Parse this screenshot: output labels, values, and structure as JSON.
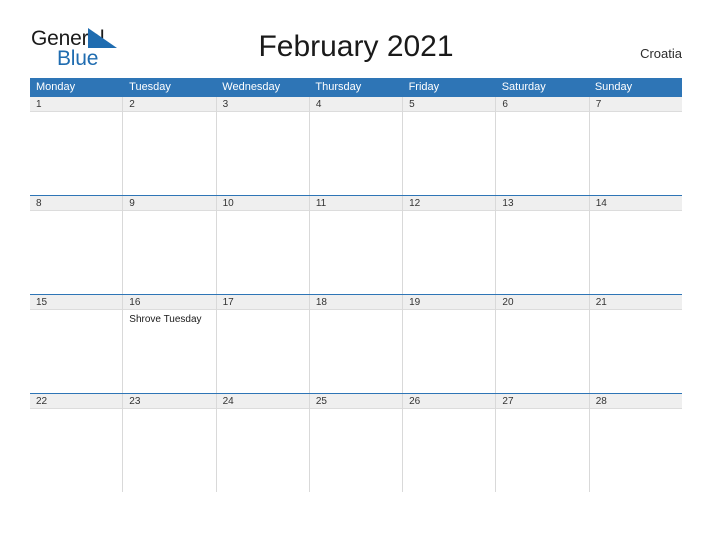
{
  "brand": {
    "name_part1": "General",
    "name_part2": "Blue",
    "flag_color": "#1f6cb0",
    "text_color": "#1a1a1a"
  },
  "header": {
    "title": "February 2021",
    "country": "Croatia"
  },
  "theme": {
    "header_blue": "#2e75b6",
    "band_gray": "#efefef",
    "divider_gray": "#d9d9d9"
  },
  "calendar": {
    "weekdays": [
      "Monday",
      "Tuesday",
      "Wednesday",
      "Thursday",
      "Friday",
      "Saturday",
      "Sunday"
    ],
    "weeks": [
      {
        "days": [
          {
            "number": "1",
            "events": []
          },
          {
            "number": "2",
            "events": []
          },
          {
            "number": "3",
            "events": []
          },
          {
            "number": "4",
            "events": []
          },
          {
            "number": "5",
            "events": []
          },
          {
            "number": "6",
            "events": []
          },
          {
            "number": "7",
            "events": []
          }
        ]
      },
      {
        "days": [
          {
            "number": "8",
            "events": []
          },
          {
            "number": "9",
            "events": []
          },
          {
            "number": "10",
            "events": []
          },
          {
            "number": "11",
            "events": []
          },
          {
            "number": "12",
            "events": []
          },
          {
            "number": "13",
            "events": []
          },
          {
            "number": "14",
            "events": []
          }
        ]
      },
      {
        "days": [
          {
            "number": "15",
            "events": []
          },
          {
            "number": "16",
            "events": [
              "Shrove Tuesday"
            ]
          },
          {
            "number": "17",
            "events": []
          },
          {
            "number": "18",
            "events": []
          },
          {
            "number": "19",
            "events": []
          },
          {
            "number": "20",
            "events": []
          },
          {
            "number": "21",
            "events": []
          }
        ]
      },
      {
        "days": [
          {
            "number": "22",
            "events": []
          },
          {
            "number": "23",
            "events": []
          },
          {
            "number": "24",
            "events": []
          },
          {
            "number": "25",
            "events": []
          },
          {
            "number": "26",
            "events": []
          },
          {
            "number": "27",
            "events": []
          },
          {
            "number": "28",
            "events": []
          }
        ]
      }
    ]
  }
}
